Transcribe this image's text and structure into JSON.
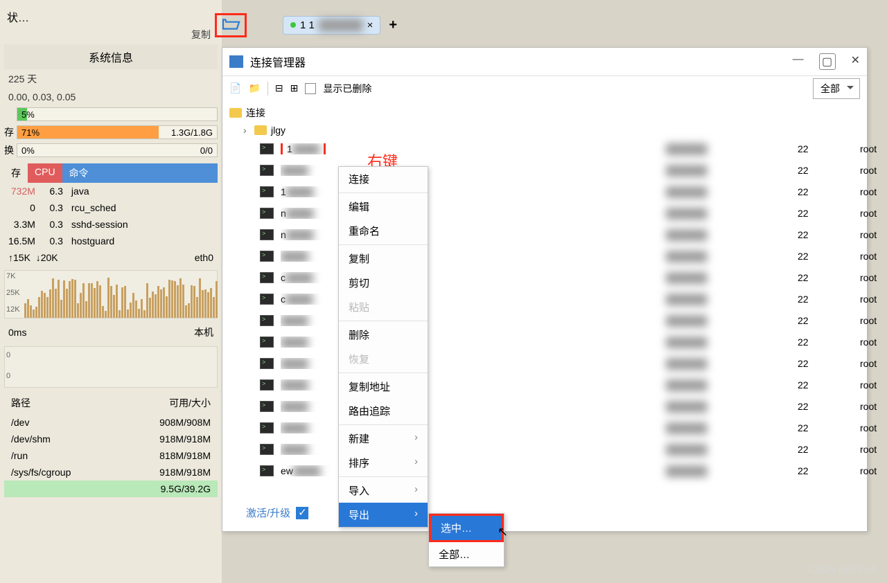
{
  "left": {
    "title_frag": "状…",
    "copy": "复制",
    "section_sys": "系统信息",
    "uptime": "225 天",
    "load": "0.00, 0.03, 0.05",
    "bars": [
      {
        "lbl": "",
        "pct": "5%",
        "right": "",
        "color": "green",
        "w": 5
      },
      {
        "lbl": "存",
        "pct": "71%",
        "right": "1.3G/1.8G",
        "color": "orange",
        "w": 71
      },
      {
        "lbl": "换",
        "pct": "0%",
        "right": "0/0",
        "color": "green",
        "w": 0
      }
    ],
    "tab_mem": "存",
    "tab_cpu": "CPU",
    "tab_cmd": "命令",
    "procs": [
      {
        "mem": "732M",
        "cpu": "6.3",
        "cmd": "java",
        "mc": "#d85c5c"
      },
      {
        "mem": "0",
        "cpu": "0.3",
        "cmd": "rcu_sched",
        "mc": "#333"
      },
      {
        "mem": "3.3M",
        "cpu": "0.3",
        "cmd": "sshd-session",
        "mc": "#333"
      },
      {
        "mem": "16.5M",
        "cpu": "0.3",
        "cmd": "hostguard",
        "mc": "#333"
      }
    ],
    "net_up": "↑15K",
    "net_down": "↓20K",
    "net_if": "eth0",
    "y_labels": [
      "7K",
      "25K",
      "12K"
    ],
    "lat": "0ms",
    "lat_r": "本机",
    "path_h1": "路径",
    "path_h2": "可用/大小",
    "fs": [
      {
        "p": "/dev",
        "s": "908M/908M"
      },
      {
        "p": "/dev/shm",
        "s": "918M/918M"
      },
      {
        "p": "/run",
        "s": "818M/918M"
      },
      {
        "p": "/sys/fs/cgroup",
        "s": "918M/918M"
      },
      {
        "p": "",
        "s": "9.5G/39.2G"
      }
    ]
  },
  "top": {
    "tab_text": "1 1",
    "tab_close": "×",
    "plus": "+"
  },
  "rt_label": "右键",
  "cm": {
    "title": "连接管理器",
    "show_deleted": "显示已删除",
    "filter": "全部",
    "root": "连接",
    "group": "jlgy",
    "hosts": [
      {
        "name": "1",
        "port": "22",
        "user": "root"
      },
      {
        "name": "",
        "port": "22",
        "user": "root"
      },
      {
        "name": "1",
        "port": "22",
        "user": "root"
      },
      {
        "name": "n",
        "port": "22",
        "user": "root"
      },
      {
        "name": "n",
        "port": "22",
        "user": "root"
      },
      {
        "name": "",
        "port": "22",
        "user": "root"
      },
      {
        "name": "c",
        "port": "22",
        "user": "root"
      },
      {
        "name": "c",
        "port": "22",
        "user": "root"
      },
      {
        "name": "",
        "port": "22",
        "user": "root"
      },
      {
        "name": "",
        "port": "22",
        "user": "root"
      },
      {
        "name": "",
        "port": "22",
        "user": "root"
      },
      {
        "name": "",
        "port": "22",
        "user": "root"
      },
      {
        "name": "",
        "port": "22",
        "user": "root"
      },
      {
        "name": "",
        "port": "22",
        "user": "root"
      },
      {
        "name": "",
        "port": "22",
        "user": "root"
      },
      {
        "name": "ew",
        "port": "22",
        "user": "root"
      }
    ],
    "activate": "激活/升级"
  },
  "ctx": {
    "items": [
      {
        "t": "连接",
        "sep": true
      },
      {
        "t": "编辑"
      },
      {
        "t": "重命名",
        "sep": true
      },
      {
        "t": "复制"
      },
      {
        "t": "剪切"
      },
      {
        "t": "粘贴",
        "dis": true,
        "sep": true
      },
      {
        "t": "删除"
      },
      {
        "t": "恢复",
        "dis": true,
        "sep": true
      },
      {
        "t": "复制地址"
      },
      {
        "t": "路由追踪",
        "sep": true
      },
      {
        "t": "新建",
        "arrow": true
      },
      {
        "t": "排序",
        "arrow": true,
        "sep": true
      },
      {
        "t": "导入",
        "arrow": true
      },
      {
        "t": "导出",
        "arrow": true,
        "active": true
      }
    ]
  },
  "sub": {
    "selected": "选中…",
    "all": "全部…"
  },
  "watermark": "CSDN @修心光"
}
